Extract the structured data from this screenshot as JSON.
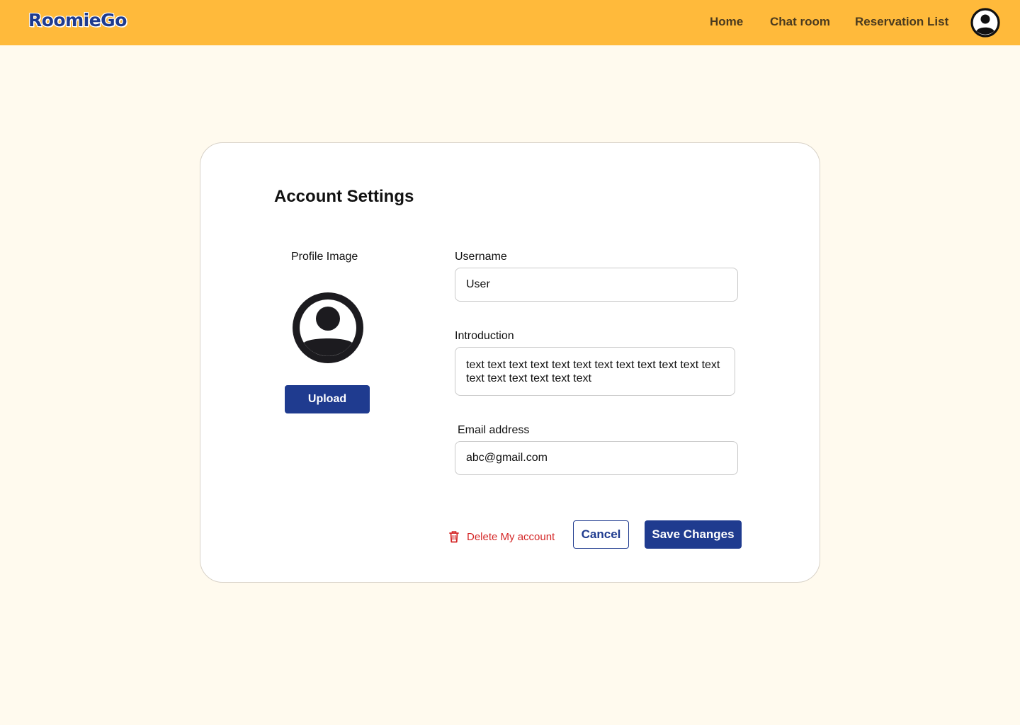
{
  "header": {
    "logo": "RoomieGo",
    "nav": [
      "Home",
      "Chat room",
      "Reservation List"
    ],
    "avatar_icon": "user-circle-icon",
    "background": "#FFBA3B"
  },
  "page": {
    "title": "Account Settings",
    "profile": {
      "label": "Profile Image",
      "avatar_icon": "user-circle-icon",
      "upload_label": "Upload"
    },
    "fields": {
      "username": {
        "label": "Username",
        "value": "User"
      },
      "introduction": {
        "label": "Introduction",
        "value": "text text text text text text text text text text text text text text text text text text"
      },
      "email": {
        "label": "Email address",
        "value": "abc@gmail.com"
      }
    },
    "actions": {
      "delete_label": "Delete My account",
      "delete_icon": "trash-icon",
      "cancel_label": "Cancel",
      "save_label": "Save Changes"
    }
  },
  "colors": {
    "brand": "#1F3B8F",
    "danger": "#D42626",
    "page_background": "#FFFAEE"
  }
}
